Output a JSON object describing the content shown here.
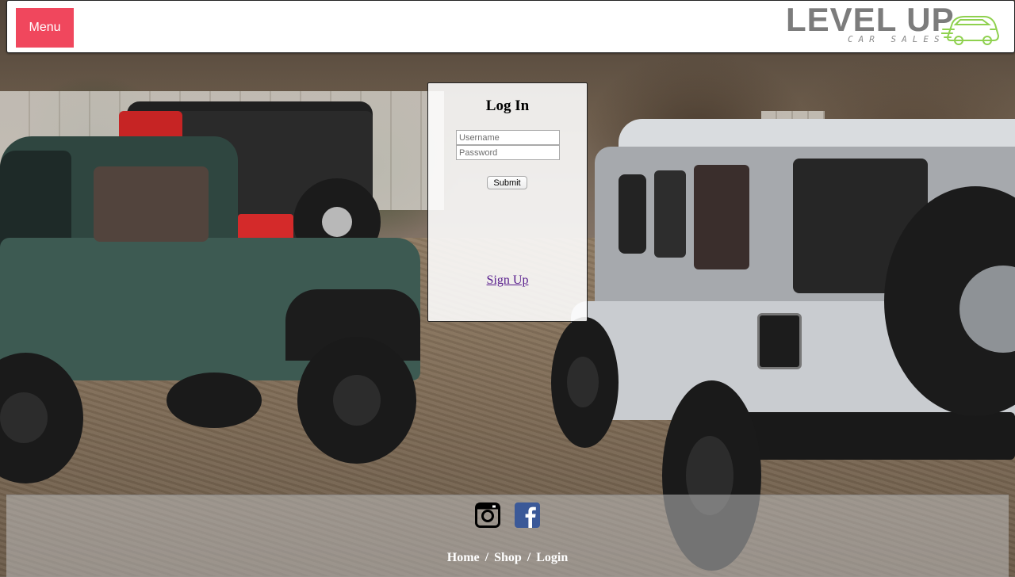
{
  "header": {
    "menu_label": "Menu",
    "logo": {
      "title": "LEVEL UP",
      "subtitle": "CAR SALES",
      "accent_color": "#8fd14f",
      "text_color": "#7c7c7c"
    }
  },
  "login": {
    "title": "Log In",
    "username_placeholder": "Username",
    "password_placeholder": "Password",
    "submit_label": "Submit",
    "signup_label": "Sign Up"
  },
  "footer": {
    "social": [
      {
        "name": "instagram-icon",
        "color": "#000000"
      },
      {
        "name": "facebook-icon",
        "color": "#3b5998"
      }
    ],
    "nav": [
      {
        "label": "Home"
      },
      {
        "label": "Shop"
      },
      {
        "label": "Login"
      }
    ],
    "separator": "/"
  },
  "colors": {
    "menu_button": "#f0475d",
    "link_visited": "#551a8b"
  }
}
